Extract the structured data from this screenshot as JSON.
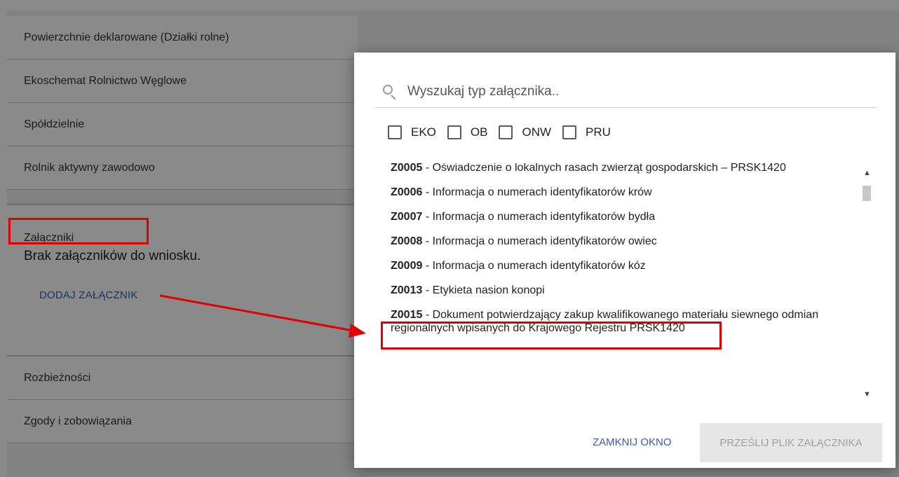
{
  "sections": {
    "declared_areas": "Powierzchnie deklarowane (Działki rolne)",
    "carbon_eco_scheme": "Ekoschemat Rolnictwo Węglowe",
    "cooperatives": "Spółdzielnie",
    "active_farmer": "Rolnik aktywny zawodowo",
    "discrepancies": "Rozbieżności",
    "consents": "Zgody i zobowiązania"
  },
  "attachments": {
    "title": "Załączniki",
    "empty_text": "Brak załączników do wniosku.",
    "add_label": "DODAJ ZAŁĄCZNIK"
  },
  "modal": {
    "search_placeholder": "Wyszukaj typ załącznika..",
    "filters": [
      {
        "label": "EKO",
        "checked": false
      },
      {
        "label": "OB",
        "checked": false
      },
      {
        "label": "ONW",
        "checked": false
      },
      {
        "label": "PRU",
        "checked": false
      }
    ],
    "items": [
      {
        "code": "Z0005",
        "text": " - Oświadczenie o lokalnych rasach zwierząt gospodarskich – PRSK1420"
      },
      {
        "code": "Z0006",
        "text": " - Informacja o numerach identyfikatorów krów"
      },
      {
        "code": "Z0007",
        "text": " - Informacja o numerach identyfikatorów bydła"
      },
      {
        "code": "Z0008",
        "text": " - Informacja o numerach identyfikatorów owiec"
      },
      {
        "code": "Z0009",
        "text": " - Informacja o numerach identyfikatorów kóz"
      },
      {
        "code": "Z0013",
        "text": " - Etykieta nasion konopi"
      },
      {
        "code": "Z0015",
        "text": " - Dokument potwierdzający zakup kwalifikowanego materiału siewnego odmian regionalnych wpisanych do Krajowego Rejestru PRSK1420"
      }
    ],
    "close_label": "ZAMKNIJ OKNO",
    "send_label": "PRZEŚLIJ PLIK ZAŁĄCZNIKA"
  },
  "colors": {
    "accent": "#3a5ea8",
    "highlight": "#e00000",
    "disabled_bg": "#e6e6e6",
    "disabled_text": "#a0a0a0"
  }
}
